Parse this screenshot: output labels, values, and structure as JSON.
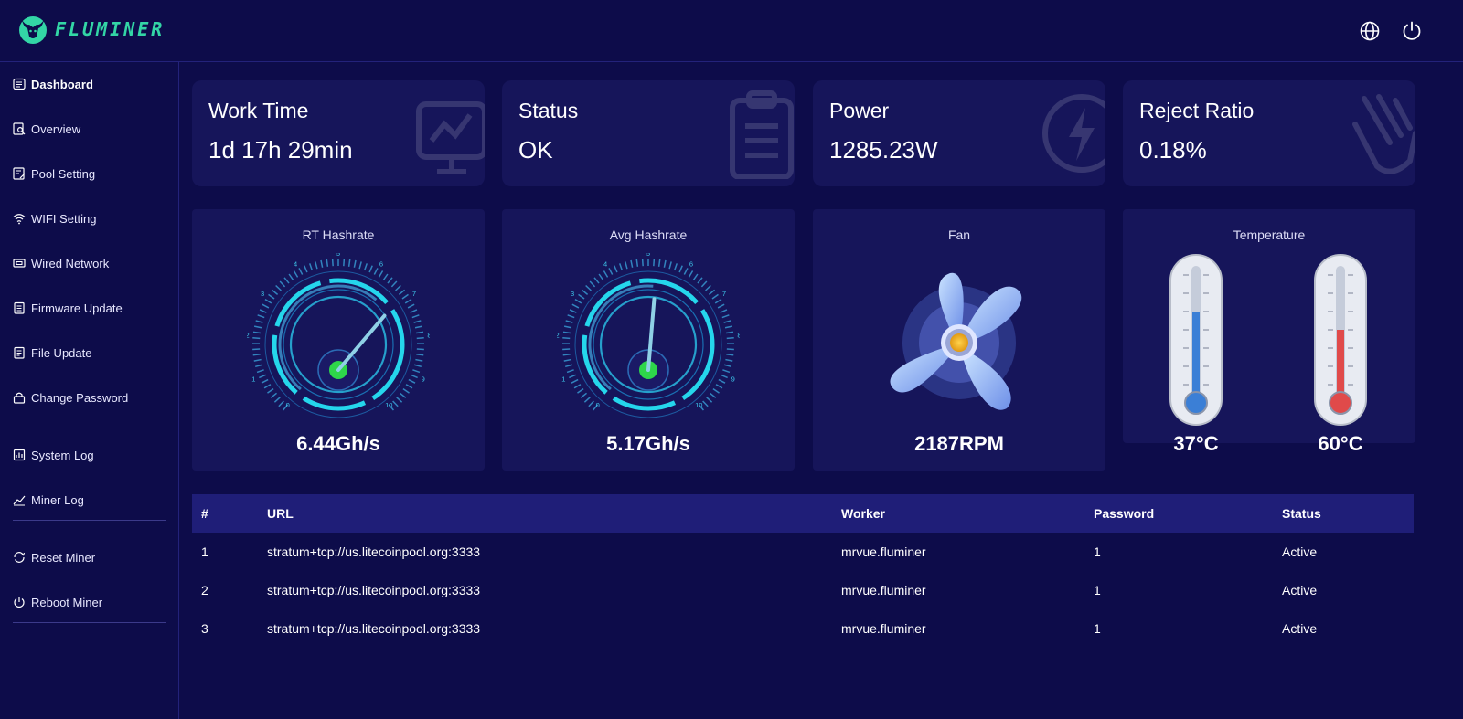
{
  "app": {
    "logo_text": "FLUMINER",
    "brand_color": "#33d6a6"
  },
  "header": {
    "language_icon": "globe-icon",
    "power_icon": "power-icon"
  },
  "sidebar": {
    "items": [
      {
        "label": "Dashboard",
        "icon": "dashboard-icon",
        "active": true
      },
      {
        "label": "Overview",
        "icon": "overview-icon"
      },
      {
        "label": "Pool Setting",
        "icon": "pool-setting-icon"
      },
      {
        "label": "WIFI Setting",
        "icon": "wifi-icon"
      },
      {
        "label": "Wired Network",
        "icon": "network-icon"
      },
      {
        "label": "Firmware Update",
        "icon": "firmware-icon"
      },
      {
        "label": "File Update",
        "icon": "file-icon"
      },
      {
        "label": "Change Password",
        "icon": "lock-icon"
      },
      {
        "label": "System Log",
        "icon": "system-log-icon"
      },
      {
        "label": "Miner Log",
        "icon": "chart-line-icon"
      },
      {
        "label": "Reset Miner",
        "icon": "reset-icon"
      },
      {
        "label": "Reboot Miner",
        "icon": "power-icon"
      }
    ]
  },
  "stats": {
    "work_time": {
      "title": "Work Time",
      "value": "1d 17h 29min"
    },
    "status": {
      "title": "Status",
      "value": "OK"
    },
    "power": {
      "title": "Power",
      "value": "1285.23W"
    },
    "reject_ratio": {
      "title": "Reject Ratio",
      "value": "0.18%"
    }
  },
  "gauges": {
    "rt_hashrate": {
      "title": "RT Hashrate",
      "value": "6.44Gh/s",
      "reading": 6.44
    },
    "avg_hashrate": {
      "title": "Avg Hashrate",
      "value": "5.17Gh/s",
      "reading": 5.17
    },
    "ticks": [
      "0",
      "1",
      "2",
      "3",
      "4",
      "5",
      "6",
      "7",
      "8",
      "9",
      "10"
    ]
  },
  "fan": {
    "title": "Fan",
    "value": "2187RPM"
  },
  "temperature": {
    "title": "Temperature",
    "low": {
      "value": "37°C",
      "color": "#3b7fd6"
    },
    "high": {
      "value": "60°C",
      "color": "#e04a4a"
    }
  },
  "pool_table": {
    "headers": [
      "#",
      "URL",
      "Worker",
      "Password",
      "Status"
    ],
    "rows": [
      [
        "1",
        "stratum+tcp://us.litecoinpool.org:3333",
        "mrvue.fluminer",
        "1",
        "Active"
      ],
      [
        "2",
        "stratum+tcp://us.litecoinpool.org:3333",
        "mrvue.fluminer",
        "1",
        "Active"
      ],
      [
        "3",
        "stratum+tcp://us.litecoinpool.org:3333",
        "mrvue.fluminer",
        "1",
        "Active"
      ]
    ]
  }
}
